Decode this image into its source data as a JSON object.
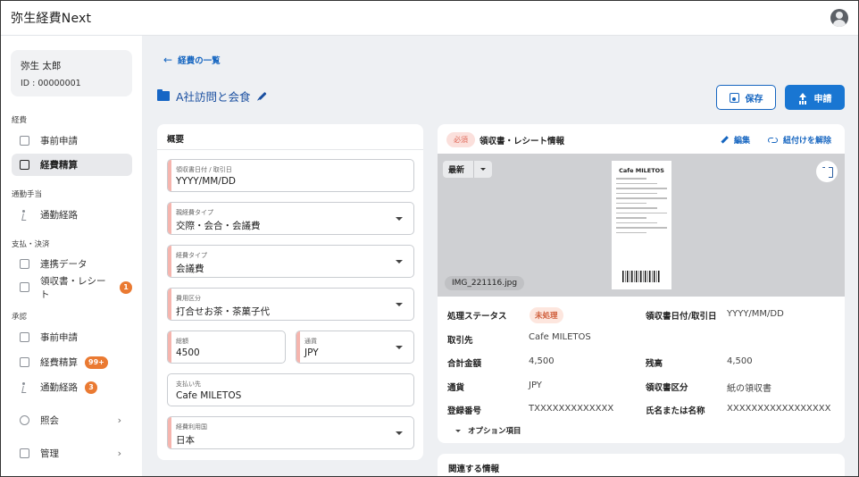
{
  "app": {
    "title": "弥生経費Next"
  },
  "user": {
    "name": "弥生 太郎",
    "id_text": "ID : 00000001"
  },
  "sidebar": {
    "sections": [
      {
        "label": "経費"
      },
      {
        "label": "通勤手当"
      },
      {
        "label": "支払・決済"
      },
      {
        "label": "承認"
      }
    ],
    "items": [
      {
        "label": "事前申請"
      },
      {
        "label": "経費精算"
      },
      {
        "label": "通勤経路"
      },
      {
        "label": "連携データ"
      },
      {
        "label": "領収書・レシート",
        "badge": "1"
      },
      {
        "label": "事前申請"
      },
      {
        "label": "経費精算",
        "badge": "99+"
      },
      {
        "label": "通勤経路",
        "badge": "3"
      },
      {
        "label": "照会",
        "chevron": "›"
      },
      {
        "label": "管理",
        "chevron": "›"
      }
    ]
  },
  "header": {
    "back_label": "経費の一覧",
    "back_arrow": "←",
    "page_title": "A社訪問と会食",
    "save_label": "保存",
    "apply_label": "申請"
  },
  "summary": {
    "title": "概要",
    "fields": [
      {
        "label": "領収書日付 / 取引日",
        "value": "YYYY/MM/DD"
      },
      {
        "label": "親経費タイプ",
        "value": "交際・会合・会議費"
      },
      {
        "label": "経費タイプ",
        "value": "会議費"
      },
      {
        "label": "費用区分",
        "value": "打合せお茶・茶菓子代"
      },
      {
        "label": "総額",
        "value": "4500"
      },
      {
        "label": "通貨",
        "value": "JPY"
      },
      {
        "label": "支払い先",
        "value": "Cafe MILETOS"
      },
      {
        "label": "経費利用国",
        "value": "日本"
      }
    ]
  },
  "receipt": {
    "required_label": "必須",
    "title": "領収書・レシート情報",
    "edit_label": "編集",
    "unlink_label": "紐付けを解除",
    "latest_label": "最新",
    "image_shop_name": "Cafe MILETOS",
    "file_name": "IMG_221116.jpg",
    "rows": [
      {
        "label": "処理ステータス",
        "value": "未処理"
      },
      {
        "label": "領収書日付/取引日",
        "value": "YYYY/MM/DD"
      },
      {
        "label": "取引先",
        "value": "Cafe MILETOS"
      },
      {
        "label": "合計金額",
        "value": "4,500"
      },
      {
        "label": "残高",
        "value": "4,500"
      },
      {
        "label": "通貨",
        "value": "JPY"
      },
      {
        "label": "領収書区分",
        "value": "紙の領収書"
      },
      {
        "label": "登録番号",
        "value": "TXXXXXXXXXXXXX"
      },
      {
        "label": "氏名または名称",
        "value": "XXXXXXXXXXXXXXXXX"
      }
    ],
    "options_label": "オプション項目"
  },
  "related": {
    "title": "関連する情報"
  },
  "colors": {
    "accent": "#1976d2",
    "badge": "#ea7a32",
    "required_bar": "#f5b5ae"
  }
}
